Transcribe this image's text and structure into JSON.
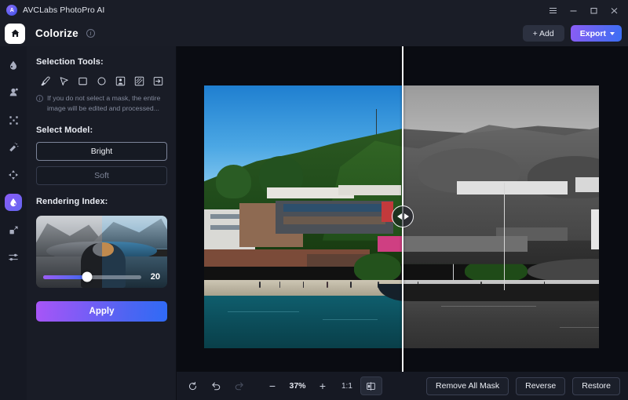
{
  "titlebar": {
    "app_name": "AVCLabs PhotoPro AI",
    "logo_text": "A",
    "controls": [
      {
        "name": "menu-button",
        "glyph": "menu"
      },
      {
        "name": "minimize-button",
        "glyph": "minimize"
      },
      {
        "name": "maximize-button",
        "glyph": "maximize"
      },
      {
        "name": "close-button",
        "glyph": "close"
      }
    ]
  },
  "header": {
    "home_icon": "home-icon",
    "title": "Colorize",
    "info_icon": "i",
    "add_label": "+ Add",
    "export_label": "Export"
  },
  "rail": {
    "items": [
      {
        "name": "rail-item-enhance",
        "icon": "droplet-icon",
        "active": false
      },
      {
        "name": "rail-item-retouch",
        "icon": "portrait-retouch-icon",
        "active": false
      },
      {
        "name": "rail-item-upscale",
        "icon": "expand-icon",
        "active": false
      },
      {
        "name": "rail-item-remove",
        "icon": "magic-eraser-icon",
        "active": false
      },
      {
        "name": "rail-item-background",
        "icon": "four-arrows-icon",
        "active": false
      },
      {
        "name": "rail-item-colorize",
        "icon": "color-drop-icon",
        "active": true
      },
      {
        "name": "rail-item-resize",
        "icon": "resize-icon",
        "active": false
      },
      {
        "name": "rail-item-adjust",
        "icon": "sliders-icon",
        "active": false
      }
    ]
  },
  "panel": {
    "selection_tools_label": "Selection Tools:",
    "tools": [
      {
        "name": "brush-tool-icon",
        "icon": "brush"
      },
      {
        "name": "lasso-tool-icon",
        "icon": "cursor"
      },
      {
        "name": "rectangle-select-icon",
        "icon": "rectangle"
      },
      {
        "name": "ellipse-select-icon",
        "icon": "ellipse"
      },
      {
        "name": "subject-select-icon",
        "icon": "portrait"
      },
      {
        "name": "texture-select-icon",
        "icon": "hatched"
      },
      {
        "name": "import-mask-icon",
        "icon": "arrow-in-box"
      }
    ],
    "hint_text": "If you do not select a mask, the entire image will be edited and processed...",
    "select_model_label": "Select Model:",
    "models": [
      {
        "label": "Bright",
        "selected": true
      },
      {
        "label": "Soft",
        "selected": false
      }
    ],
    "rendering_index_label": "Rendering Index:",
    "rendering_index_value": "20",
    "rendering_index_percent": 45,
    "apply_label": "Apply"
  },
  "canvas": {
    "split_position_percent": 50,
    "left_arrow": "arrow-left-icon",
    "right_arrow": "arrow-right-icon",
    "background_color": "#0a0c12"
  },
  "bottombar": {
    "reset_icon": "reset-icon",
    "undo_icon": "undo-icon",
    "redo_icon": "redo-icon",
    "zoom_out_label": "−",
    "zoom_level": "37%",
    "zoom_in_label": "+",
    "fit_label": "1:1",
    "compare_icon": "split-view-icon",
    "actions": [
      {
        "name": "remove-all-mask-button",
        "label": "Remove All Mask"
      },
      {
        "name": "reverse-button",
        "label": "Reverse"
      },
      {
        "name": "restore-button",
        "label": "Restore"
      }
    ]
  },
  "colors": {
    "accent_purple": "#8b5cf6",
    "accent_blue": "#3b6ef5",
    "panel_bg": "#191c26",
    "canvas_bg": "#0a0c12",
    "sky_blue": "#3c9bdd",
    "water_teal": "#11606b"
  }
}
